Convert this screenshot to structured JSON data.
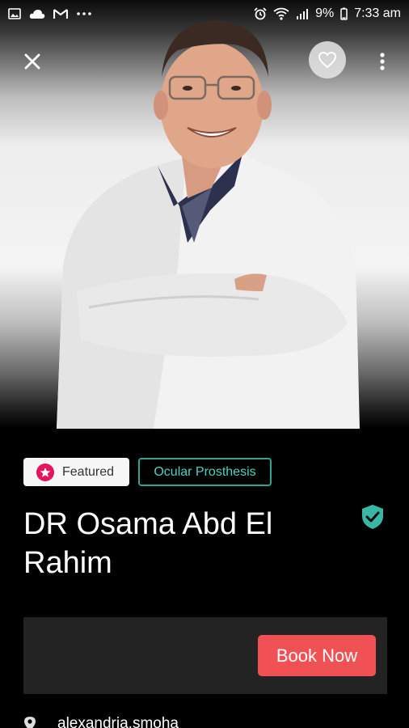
{
  "status_bar": {
    "time": "7:33 am",
    "battery": "9%",
    "icons": [
      "gallery-icon",
      "cloud-icon",
      "gmail-icon",
      "more-dots-icon",
      "alarm-icon",
      "wifi-icon",
      "signal-icon",
      "battery-icon"
    ]
  },
  "header": {
    "close_icon": "close-icon",
    "favorite_icon": "heart-icon",
    "more_icon": "more-vertical-icon"
  },
  "tags": {
    "featured": "Featured",
    "specialty": "Ocular Prosthesis"
  },
  "doctor": {
    "name": "DR Osama Abd El Rahim",
    "verified_icon": "verified-shield-icon"
  },
  "booking": {
    "button_label": "Book Now"
  },
  "location": {
    "icon": "location-pin-icon",
    "text": "alexandria,smoha"
  },
  "colors": {
    "accent_red": "#f05154",
    "featured_pink": "#e2155d",
    "teal": "#2aa596",
    "panel": "#232323",
    "background": "#000000"
  }
}
